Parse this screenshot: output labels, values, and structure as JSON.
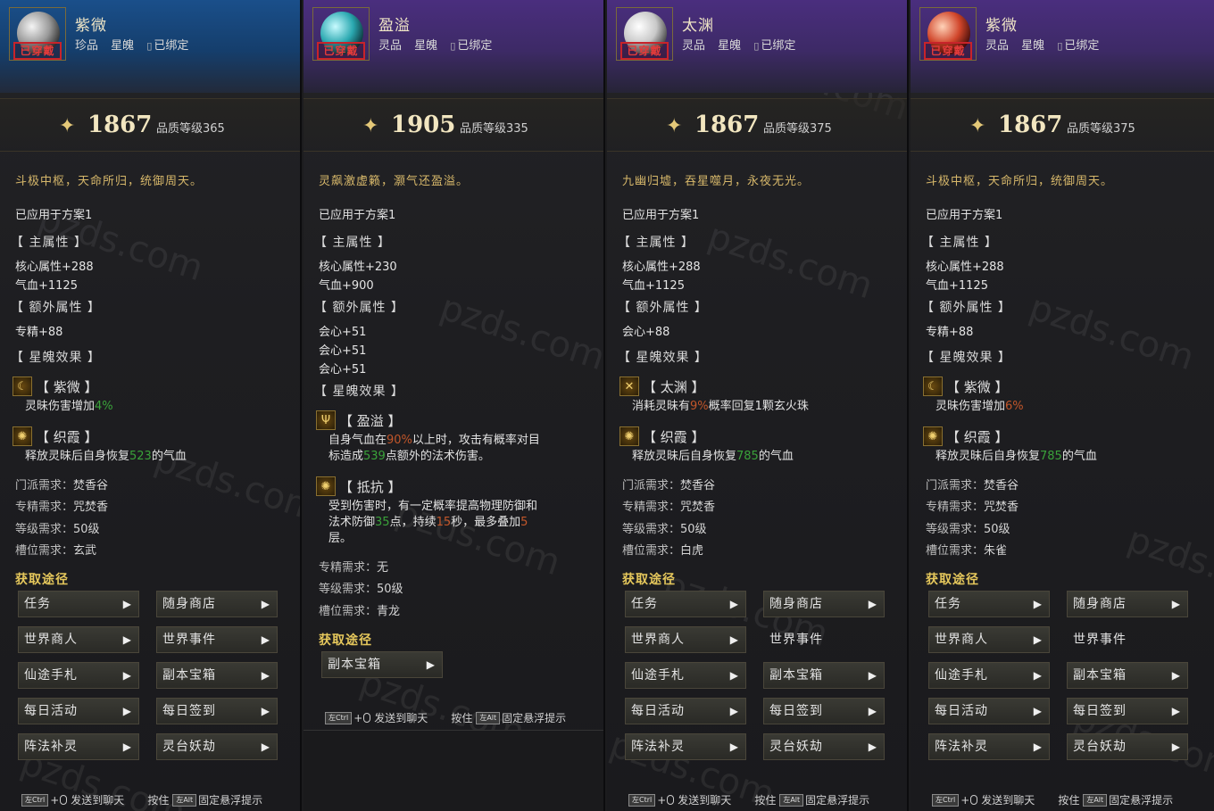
{
  "panels": [
    {
      "name": "紫微",
      "header_theme": "blue",
      "orb_color": "#9a9a9a",
      "stamp": "已穿戴",
      "grade": "珍品",
      "type": "星魄",
      "bind": "已绑定",
      "score": "1867",
      "quality": "品质等级365",
      "motto": "斗极中枢，天命所归，统御周天。",
      "applied": "已应用于方案1",
      "main_attr_title": "【 主属性 】",
      "main_attrs": [
        "核心属性+288",
        "气血+1125"
      ],
      "extra_attr_title": "【 额外属性 】",
      "extra_attrs": [
        "专精+88"
      ],
      "effect_title": "【 星魄效果 】",
      "effects": [
        {
          "icon": "crescent-icon",
          "icon_glyph": "☾",
          "name": "【 紫微 】",
          "text_before": "灵昧伤害增加",
          "value": "4%",
          "text_after": ""
        },
        {
          "icon": "spiral-icon",
          "icon_glyph": "✺",
          "name": "【 织霞 】",
          "text_before": "释放灵昧后自身恢复",
          "value": "523",
          "text_after": "的气血"
        }
      ],
      "requirements": [
        {
          "key": "门派需求：",
          "value": "焚香谷"
        },
        {
          "key": "专精需求：",
          "value": "咒焚香"
        },
        {
          "key": "等级需求：",
          "value": "50级"
        },
        {
          "key": "槽位需求：",
          "value": "玄武"
        }
      ],
      "acquire_title": "获取途径",
      "buttons": [
        {
          "label": "任务",
          "arrow": true
        },
        {
          "label": "随身商店",
          "arrow": true
        },
        {
          "label": "世界商人",
          "arrow": true
        },
        {
          "label": "世界事件",
          "arrow": true
        },
        {
          "label": "仙途手札",
          "arrow": true
        },
        {
          "label": "副本宝箱",
          "arrow": true
        },
        {
          "label": "每日活动",
          "arrow": true
        },
        {
          "label": "每日签到",
          "arrow": true
        },
        {
          "label": "阵法补灵",
          "arrow": true
        },
        {
          "label": "灵台妖劫",
          "arrow": true
        }
      ],
      "footer": {
        "key1": "左Ctrl",
        "text1": "发送到聊天",
        "press": "按住",
        "key2": "左Alt",
        "text2": "固定悬浮提示"
      }
    },
    {
      "name": "盈溢",
      "header_theme": "purple",
      "orb_color": "#2aa8b0",
      "stamp": "已穿戴",
      "grade": "灵品",
      "type": "星魄",
      "bind": "已绑定",
      "score": "1905",
      "quality": "品质等级335",
      "motto": "灵飙激虚籁，灏气还盈溢。",
      "applied": "已应用于方案1",
      "main_attr_title": "【 主属性 】",
      "main_attrs": [
        "核心属性+230",
        "气血+900"
      ],
      "extra_attr_title": "【 额外属性 】",
      "extra_attrs": [
        "会心+51",
        "会心+51",
        "会心+51"
      ],
      "effect_title": "【 星魄效果 】",
      "effects": [
        {
          "icon": "trident-icon",
          "icon_glyph": "Ψ",
          "name": "【 盈溢 】",
          "line1_before": "自身气血在",
          "line1_value": "90%",
          "line1_after": "以上时，攻击有概率对目",
          "line2_before": "标造成",
          "line2_value": "539",
          "line2_after": "点额外的法术伤害。"
        },
        {
          "icon": "shield-icon",
          "icon_glyph": "✺",
          "name": "【 抵抗 】",
          "line1": "受到伤害时，有一定概率提高物理防御和",
          "line2_before": "法术防御",
          "line2_value": "35",
          "line2_mid": "点，持续",
          "line2_value2": "15",
          "line2_mid2": "秒，最多叠加",
          "line2_value3": "5",
          "line3": "层。"
        }
      ],
      "requirements": [
        {
          "key": "专精需求：",
          "value": "无"
        },
        {
          "key": "等级需求：",
          "value": "50级"
        },
        {
          "key": "槽位需求：",
          "value": "青龙"
        }
      ],
      "acquire_title": "获取途径",
      "buttons": [
        {
          "label": "副本宝箱",
          "arrow": true
        }
      ],
      "footer": {
        "key1": "左Ctrl",
        "text1": "发送到聊天",
        "press": "按住",
        "key2": "左Alt",
        "text2": "固定悬浮提示"
      }
    },
    {
      "name": "太渊",
      "header_theme": "purple",
      "orb_color": "#d0d0d0",
      "stamp": "已穿戴",
      "grade": "灵品",
      "type": "星魄",
      "bind": "已绑定",
      "score": "1867",
      "quality": "品质等级375",
      "motto": "九幽归墟，吞星噬月，永夜无光。",
      "applied": "已应用于方案1",
      "main_attr_title": "【 主属性 】",
      "main_attrs": [
        "核心属性+288",
        "气血+1125"
      ],
      "extra_attr_title": "【 额外属性 】",
      "extra_attrs": [
        "会心+88"
      ],
      "effect_title": "【 星魄效果 】",
      "effects": [
        {
          "icon": "crossed-swords-icon",
          "icon_glyph": "✕",
          "name": "【 太渊 】",
          "text_before": "消耗灵昧有",
          "value": "9%",
          "text_after": "概率回复1颗玄火珠"
        },
        {
          "icon": "spiral-icon",
          "icon_glyph": "✺",
          "name": "【 织霞 】",
          "text_before": "释放灵昧后自身恢复",
          "value": "785",
          "text_after": "的气血"
        }
      ],
      "requirements": [
        {
          "key": "门派需求：",
          "value": "焚香谷"
        },
        {
          "key": "专精需求：",
          "value": "咒焚香"
        },
        {
          "key": "等级需求：",
          "value": "50级"
        },
        {
          "key": "槽位需求：",
          "value": "白虎"
        }
      ],
      "acquire_title": "获取途径",
      "buttons": [
        {
          "label": "任务",
          "arrow": true
        },
        {
          "label": "随身商店",
          "arrow": true
        },
        {
          "label": "世界商人",
          "arrow": true
        },
        {
          "label": "世界事件",
          "arrow": false
        },
        {
          "label": "仙途手札",
          "arrow": true
        },
        {
          "label": "副本宝箱",
          "arrow": true
        },
        {
          "label": "每日活动",
          "arrow": true
        },
        {
          "label": "每日签到",
          "arrow": true
        },
        {
          "label": "阵法补灵",
          "arrow": true
        },
        {
          "label": "灵台妖劫",
          "arrow": true
        }
      ],
      "footer": {
        "key1": "左Ctrl",
        "text1": "发送到聊天",
        "press": "按住",
        "key2": "左Alt",
        "text2": "固定悬浮提示"
      }
    },
    {
      "name": "紫微",
      "header_theme": "purple",
      "orb_color": "#d0452a",
      "stamp": "已穿戴",
      "grade": "灵品",
      "type": "星魄",
      "bind": "已绑定",
      "score": "1867",
      "quality": "品质等级375",
      "motto": "斗极中枢，天命所归，统御周天。",
      "applied": "已应用于方案1",
      "main_attr_title": "【 主属性 】",
      "main_attrs": [
        "核心属性+288",
        "气血+1125"
      ],
      "extra_attr_title": "【 额外属性 】",
      "extra_attrs": [
        "专精+88"
      ],
      "effect_title": "【 星魄效果 】",
      "effects": [
        {
          "icon": "crescent-icon",
          "icon_glyph": "☾",
          "name": "【 紫微 】",
          "text_before": "灵昧伤害增加",
          "value": "6%",
          "text_after": ""
        },
        {
          "icon": "spiral-icon",
          "icon_glyph": "✺",
          "name": "【 织霞 】",
          "text_before": "释放灵昧后自身恢复",
          "value": "785",
          "text_after": "的气血"
        }
      ],
      "requirements": [
        {
          "key": "门派需求：",
          "value": "焚香谷"
        },
        {
          "key": "专精需求：",
          "value": "咒焚香"
        },
        {
          "key": "等级需求：",
          "value": "50级"
        },
        {
          "key": "槽位需求：",
          "value": "朱雀"
        }
      ],
      "acquire_title": "获取途径",
      "buttons": [
        {
          "label": "任务",
          "arrow": true
        },
        {
          "label": "随身商店",
          "arrow": true
        },
        {
          "label": "世界商人",
          "arrow": true
        },
        {
          "label": "世界事件",
          "arrow": false
        },
        {
          "label": "仙途手札",
          "arrow": true
        },
        {
          "label": "副本宝箱",
          "arrow": true
        },
        {
          "label": "每日活动",
          "arrow": true
        },
        {
          "label": "每日签到",
          "arrow": true
        },
        {
          "label": "阵法补灵",
          "arrow": true
        },
        {
          "label": "灵台妖劫",
          "arrow": true
        }
      ],
      "footer": {
        "key1": "左Ctrl",
        "text1": "发送到聊天",
        "press": "按住",
        "key2": "左Alt",
        "text2": "固定悬浮提示"
      }
    }
  ],
  "watermark": "pzds.com"
}
